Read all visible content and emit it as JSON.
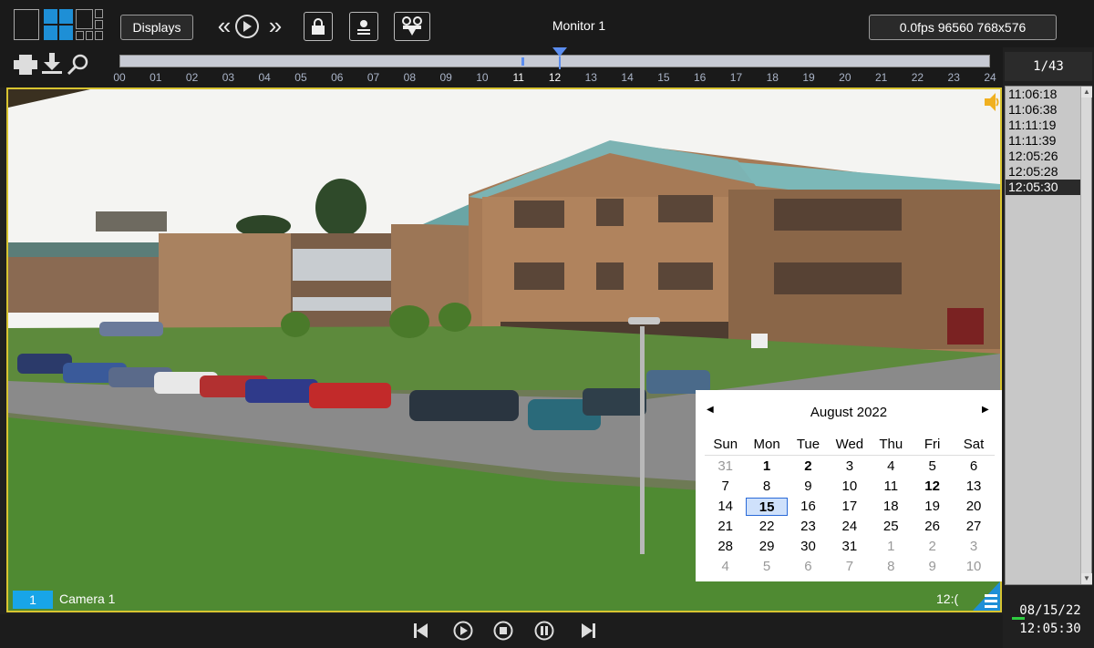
{
  "toolbar": {
    "displays_label": "Displays",
    "monitor_title": "Monitor 1",
    "stats": "0.0fps  96560  768x576"
  },
  "timeline": {
    "hours": [
      "00",
      "01",
      "02",
      "03",
      "04",
      "05",
      "06",
      "07",
      "08",
      "09",
      "10",
      "11",
      "12",
      "13",
      "14",
      "15",
      "16",
      "17",
      "18",
      "19",
      "20",
      "21",
      "22",
      "23",
      "24"
    ],
    "marker_hour": 12.15
  },
  "sidebar": {
    "counter": "1/43",
    "times": [
      "11:06:18",
      "11:06:38",
      "11:11:19",
      "11:11:39",
      "12:05:26",
      "12:05:28",
      "12:05:30"
    ],
    "selected_index": 6,
    "date": "08/15/22",
    "time": "12:05:30"
  },
  "video": {
    "camera_number": "1",
    "camera_name": "Camera 1",
    "overlay_time": "12:("
  },
  "calendar": {
    "title": "August 2022",
    "weekdays": [
      "Sun",
      "Mon",
      "Tue",
      "Wed",
      "Thu",
      "Fri",
      "Sat"
    ],
    "weeks": [
      [
        {
          "d": "31",
          "m": true
        },
        {
          "d": "1",
          "b": true
        },
        {
          "d": "2",
          "b": true
        },
        {
          "d": "3"
        },
        {
          "d": "4"
        },
        {
          "d": "5"
        },
        {
          "d": "6"
        }
      ],
      [
        {
          "d": "7"
        },
        {
          "d": "8"
        },
        {
          "d": "9"
        },
        {
          "d": "10"
        },
        {
          "d": "11"
        },
        {
          "d": "12",
          "b": true
        },
        {
          "d": "13"
        }
      ],
      [
        {
          "d": "14"
        },
        {
          "d": "15",
          "t": true
        },
        {
          "d": "16"
        },
        {
          "d": "17"
        },
        {
          "d": "18"
        },
        {
          "d": "19"
        },
        {
          "d": "20"
        }
      ],
      [
        {
          "d": "21"
        },
        {
          "d": "22"
        },
        {
          "d": "23"
        },
        {
          "d": "24"
        },
        {
          "d": "25"
        },
        {
          "d": "26"
        },
        {
          "d": "27"
        }
      ],
      [
        {
          "d": "28"
        },
        {
          "d": "29"
        },
        {
          "d": "30"
        },
        {
          "d": "31"
        },
        {
          "d": "1",
          "m": true
        },
        {
          "d": "2",
          "m": true
        },
        {
          "d": "3",
          "m": true
        }
      ],
      [
        {
          "d": "4",
          "m": true
        },
        {
          "d": "5",
          "m": true
        },
        {
          "d": "6",
          "m": true
        },
        {
          "d": "7",
          "m": true
        },
        {
          "d": "8",
          "m": true
        },
        {
          "d": "9",
          "m": true
        },
        {
          "d": "10",
          "m": true
        }
      ]
    ]
  },
  "colors": {
    "accent": "#18a5e8",
    "frame": "#d8c430",
    "marker": "#5b8df0"
  }
}
